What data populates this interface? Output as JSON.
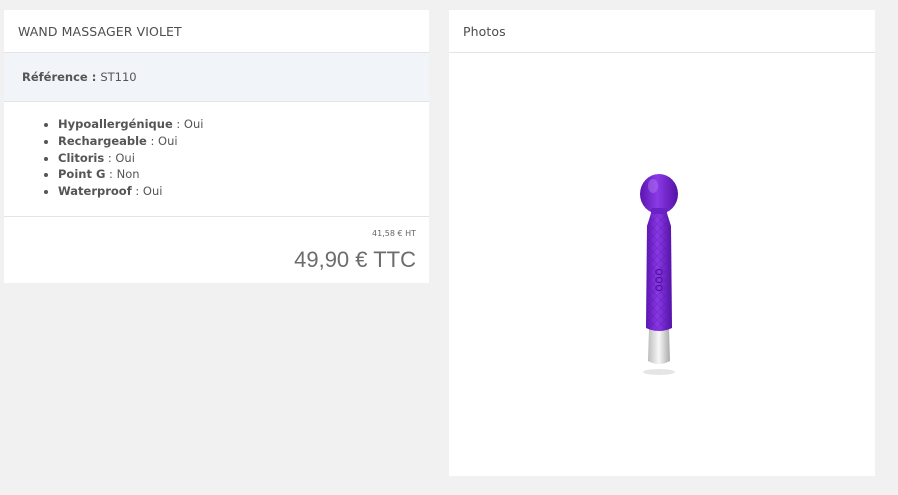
{
  "product": {
    "title": "WAND MASSAGER VIOLET",
    "reference_label": "Référence :",
    "reference_value": "ST110",
    "features": [
      {
        "label": "Hypoallergénique",
        "value": " : Oui"
      },
      {
        "label": "Rechargeable",
        "value": " : Oui"
      },
      {
        "label": "Clitoris",
        "value": " : Oui"
      },
      {
        "label": "Point G",
        "value": " : Non"
      },
      {
        "label": "Waterproof",
        "value": " : Oui"
      }
    ],
    "price_ht": "41,58 € HT",
    "price_ttc": "49,90 € TTC"
  },
  "photos": {
    "title": "Photos",
    "image_icon": "wand-massager-icon",
    "image_color": "#7d2fd8"
  }
}
